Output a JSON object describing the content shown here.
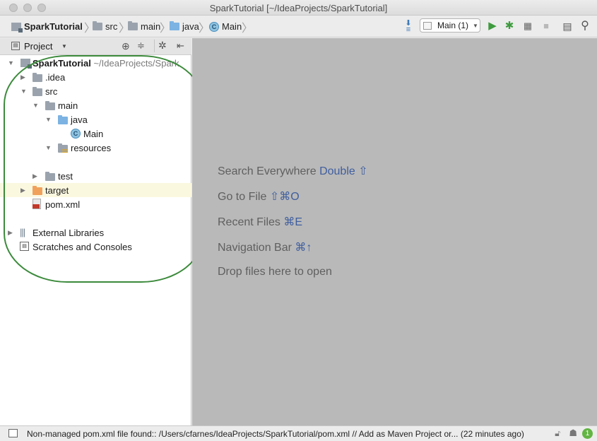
{
  "window": {
    "title": "SparkTutorial [~/IdeaProjects/SparkTutorial]"
  },
  "navbar": {
    "breadcrumbs": [
      "SparkTutorial",
      "src",
      "main",
      "java",
      "Main"
    ],
    "run_config": "Main (1)"
  },
  "project_panel": {
    "view_label": "Project",
    "tree": {
      "root": {
        "label": "SparkTutorial",
        "path": "~/IdeaProjects/Spark"
      },
      "idea": ".idea",
      "src": "src",
      "main": "main",
      "java": "java",
      "main_class": "Main",
      "resources": "resources",
      "test": "test",
      "target": "target",
      "pom": "pom.xml",
      "external_libraries": "External Libraries",
      "scratches": "Scratches and Consoles"
    }
  },
  "editor": {
    "hints": [
      {
        "label": "Search Everywhere",
        "key": "Double ⇧"
      },
      {
        "label": "Go to File",
        "key": "⇧⌘O"
      },
      {
        "label": "Recent Files",
        "key": "⌘E"
      },
      {
        "label": "Navigation Bar",
        "key": "⌘↑"
      },
      {
        "label": "Drop files here to open",
        "key": ""
      }
    ]
  },
  "statusbar": {
    "message": "Non-managed pom.xml file found:: /Users/cfarnes/IdeaProjects/SparkTutorial/pom.xml // Add as Maven Project or... (22 minutes ago)",
    "notification_count": "1"
  },
  "colors": {
    "annotation": "#3c8a3c",
    "hint_key": "#3f5e9e",
    "editor_bg": "#b9b9b9",
    "run_green": "#3e9b3e"
  }
}
